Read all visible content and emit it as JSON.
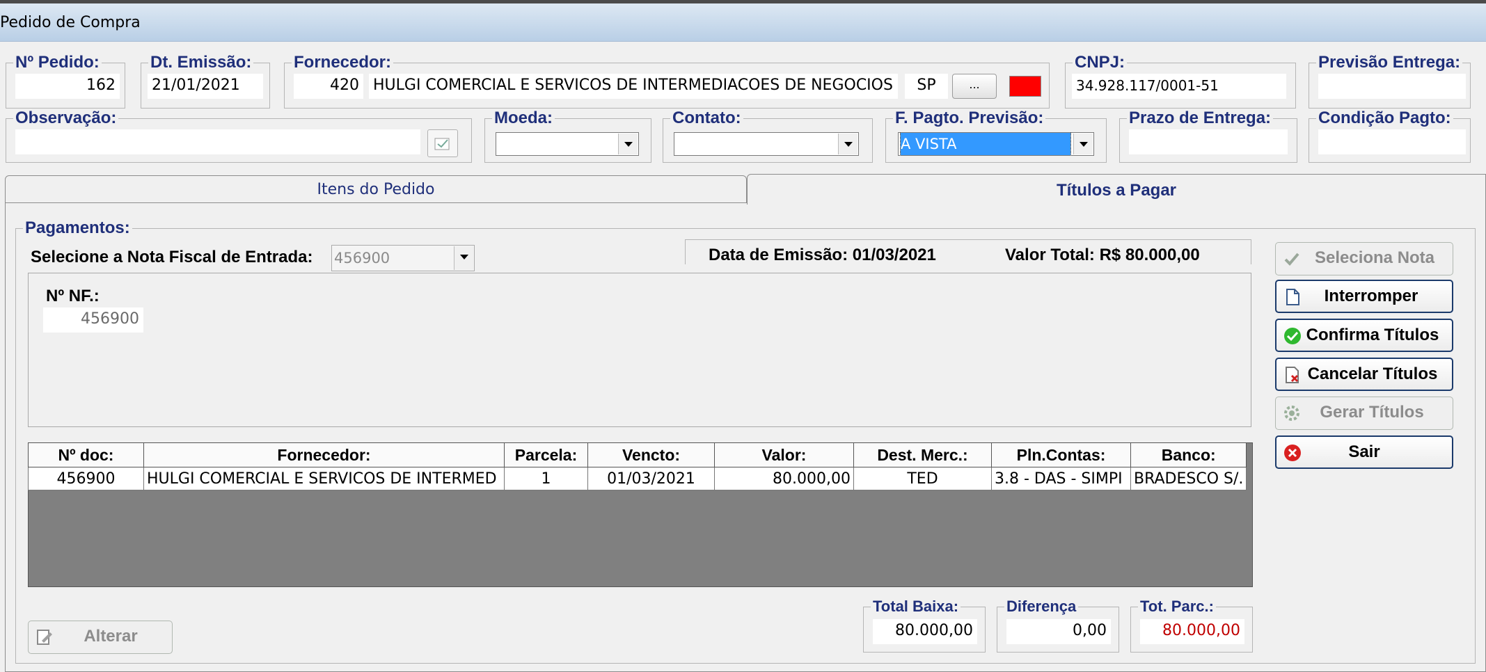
{
  "window": {
    "title": "Pedido de Compra"
  },
  "header": {
    "pedido": {
      "label": "Nº Pedido:",
      "value": "162"
    },
    "emissao": {
      "label": "Dt. Emissão:",
      "value": "21/01/2021"
    },
    "fornecedor": {
      "label": "Fornecedor:",
      "code": "420",
      "name": "HULGI COMERCIAL E SERVICOS DE INTERMEDIACOES DE NEGOCIOS",
      "uf": "SP",
      "lookup_label": "...",
      "status_color": "#ff0000"
    },
    "cnpj": {
      "label": "CNPJ:",
      "value": "34.928.117/0001-51"
    },
    "previsao_entrega": {
      "label": "Previsão Entrega:",
      "value": ""
    },
    "observacao": {
      "label": "Observação:",
      "value": ""
    },
    "moeda": {
      "label": "Moeda:",
      "value": ""
    },
    "contato": {
      "label": "Contato:",
      "value": ""
    },
    "f_pagto": {
      "label": "F. Pagto. Previsão:",
      "value": "A VISTA"
    },
    "prazo_entrega": {
      "label": "Prazo de Entrega:",
      "value": ""
    },
    "condicao_pagto": {
      "label": "Condição Pagto:",
      "value": ""
    }
  },
  "tabs": [
    {
      "label": "Itens do Pedido",
      "active": false
    },
    {
      "label": "Títulos a Pagar",
      "active": true
    }
  ],
  "pagamentos": {
    "label": "Pagamentos:",
    "nota_label": "Selecione a Nota Fiscal de Entrada:",
    "nota_value": "456900",
    "data_emissao": "Data de Emissão: 01/03/2021",
    "valor_total": "Valor Total: R$ 80.000,00",
    "nf_label": "Nº NF.:",
    "nf_value": "456900"
  },
  "grid": {
    "columns": [
      "Nº doc:",
      "Fornecedor:",
      "Parcela:",
      "Vencto:",
      "Valor:",
      "Dest. Merc.:",
      "Pln.Contas:",
      "Banco:"
    ],
    "rows": [
      [
        "456900",
        "HULGI COMERCIAL E SERVICOS DE INTERMED",
        "1",
        "01/03/2021",
        "80.000,00",
        "TED",
        "3.8 - DAS - SIMPI",
        "BRADESCO S/."
      ]
    ]
  },
  "buttons": {
    "seleciona_nota": "Seleciona Nota",
    "interromper": "Interromper",
    "confirma_titulos": "Confirma Títulos",
    "cancelar_titulos": "Cancelar Títulos",
    "gerar_titulos": "Gerar Títulos",
    "sair": "Sair",
    "alterar": "Alterar"
  },
  "totals": {
    "total_baixa": {
      "label": "Total Baixa:",
      "value": "80.000,00"
    },
    "diferenca": {
      "label": "Diferença",
      "value": "0,00"
    },
    "tot_parc": {
      "label": "Tot. Parc.:",
      "value": "80.000,00",
      "color": "#c00000"
    }
  },
  "colors": {
    "accent_label": "#1f2f7a",
    "selection": "#3399ff",
    "grid_empty": "#808080"
  }
}
